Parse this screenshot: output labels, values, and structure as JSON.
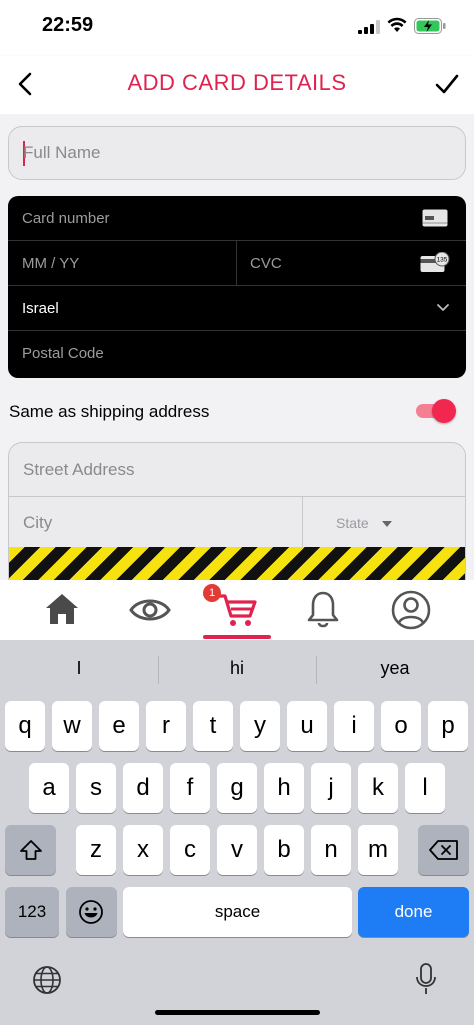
{
  "status_bar": {
    "time": "22:59"
  },
  "header": {
    "title": "ADD CARD DETAILS"
  },
  "form": {
    "full_name_placeholder": "Full Name",
    "card_number_placeholder": "Card number",
    "expiry_placeholder": "MM / YY",
    "cvc_placeholder": "CVC",
    "cvc_icon_text": "135",
    "country_value": "Israel",
    "postal_placeholder": "Postal Code",
    "same_as_shipping_label": "Same as shipping address",
    "same_as_shipping_on": true,
    "street_placeholder": "Street Address",
    "city_placeholder": "City",
    "state_placeholder": "State"
  },
  "tabbar": {
    "items": [
      {
        "name": "home",
        "icon": "home-icon"
      },
      {
        "name": "views",
        "icon": "eye-icon"
      },
      {
        "name": "cart",
        "icon": "cart-icon",
        "badge": "1",
        "active": true
      },
      {
        "name": "notifications",
        "icon": "bell-icon"
      },
      {
        "name": "profile",
        "icon": "user-circle-icon"
      }
    ],
    "accent": "#e0234e"
  },
  "keyboard": {
    "suggestions": [
      "I",
      "hi",
      "yea"
    ],
    "row1": [
      "q",
      "w",
      "e",
      "r",
      "t",
      "y",
      "u",
      "i",
      "o",
      "p"
    ],
    "row2": [
      "a",
      "s",
      "d",
      "f",
      "g",
      "h",
      "j",
      "k",
      "l"
    ],
    "row3": [
      "z",
      "x",
      "c",
      "v",
      "b",
      "n",
      "m"
    ],
    "numbers_key": "123",
    "space_key": "space",
    "done_key": "done"
  },
  "colors": {
    "accent": "#e0234e",
    "done_blue": "#1e7cf5",
    "toggle_on": "#f2274f"
  }
}
